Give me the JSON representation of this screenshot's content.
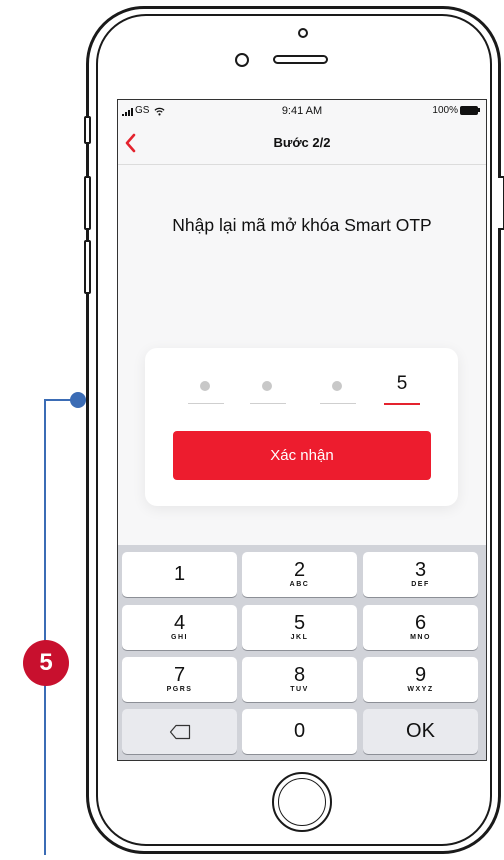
{
  "status_bar": {
    "carrier": "GS",
    "time": "9:41 AM",
    "battery": "100%"
  },
  "nav": {
    "title": "Bước 2/2"
  },
  "screen": {
    "heading": "Nhập lại mã mở khóa Smart OTP"
  },
  "pin": {
    "entered": [
      "",
      "",
      "",
      "5"
    ],
    "active_index": 3
  },
  "confirm_label": "Xác nhận",
  "keypad": {
    "keys": [
      {
        "num": "1",
        "sub": ""
      },
      {
        "num": "2",
        "sub": "ABC"
      },
      {
        "num": "3",
        "sub": "DEF"
      },
      {
        "num": "4",
        "sub": "GHI"
      },
      {
        "num": "5",
        "sub": "JKL"
      },
      {
        "num": "6",
        "sub": "MNO"
      },
      {
        "num": "7",
        "sub": "PGRS"
      },
      {
        "num": "8",
        "sub": "TUV"
      },
      {
        "num": "9",
        "sub": "WXYZ"
      }
    ],
    "zero": "0",
    "ok": "OK",
    "delete_icon": "backspace-icon"
  },
  "annotation": {
    "step_number": "5"
  },
  "colors": {
    "accent": "#ed1c2e",
    "badge": "#c8102e",
    "annotation": "#3b6cb5"
  }
}
